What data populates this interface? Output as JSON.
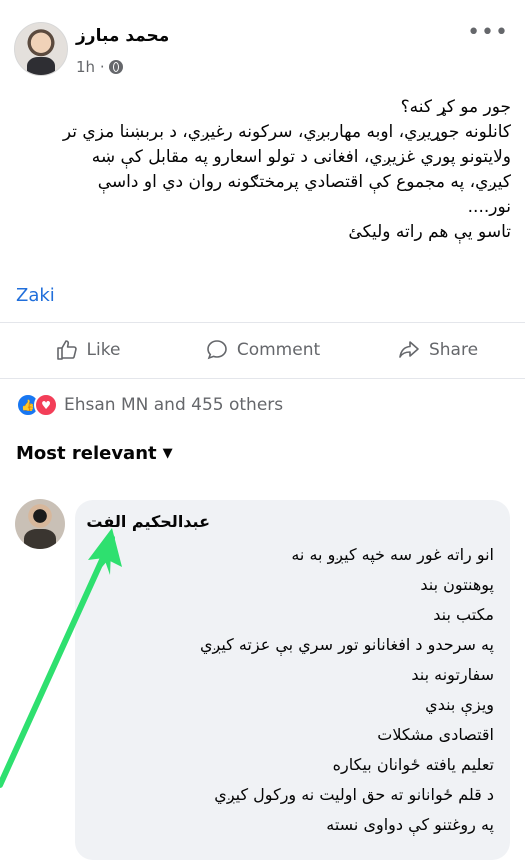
{
  "post": {
    "author": "محمد مبارز",
    "time": "1h ·",
    "privacy_icon": "globe-icon",
    "more_icon": "more-icon",
    "lines": [
      "جور مو کړ کنه؟",
      "کانلونه جوړیږي، اوبه مهاربږي، سرکونه رغیږي، د بربښنا مزي تر",
      "ولایتونو پوري غزیږي، افغانی د تولو اسعارو په مقابل کې ښه",
      "کیږي، په مجموع کې اقتصادي پرمختګونه روان دي او داسې",
      "نور....",
      "تاسو یې هم راته ولیکئ"
    ],
    "tag": "Zaki"
  },
  "actions": {
    "like": "Like",
    "comment": "Comment",
    "share": "Share"
  },
  "reactions": {
    "text": "Ehsan MN and 455 others",
    "icons": [
      "like-icon",
      "love-icon"
    ]
  },
  "comments_filter": {
    "label": "Most relevant"
  },
  "comment": {
    "author": "عبدالحکیم الفت",
    "lines": [
      "انو راته غور سه خپه کیږو به نه",
      "پوهنتون بند",
      "مکتب بند",
      "په سرحدو د افغانانو تور سري بې عزته کیږي",
      "سفارتونه بند",
      "ویزې بندي",
      "اقتصادی مشکلات",
      "تعلیم یافته ځوانان بیکاره",
      "د قلم ځوانانو ته حق اولیت نه ورکول کیږي",
      "په روغتنو کې دواوی نسته"
    ]
  },
  "colors": {
    "accent": "#216fdb",
    "annotation_arrow": "#2ee06f",
    "bubble": "#f0f2f5",
    "secondary_text": "#65676b"
  }
}
